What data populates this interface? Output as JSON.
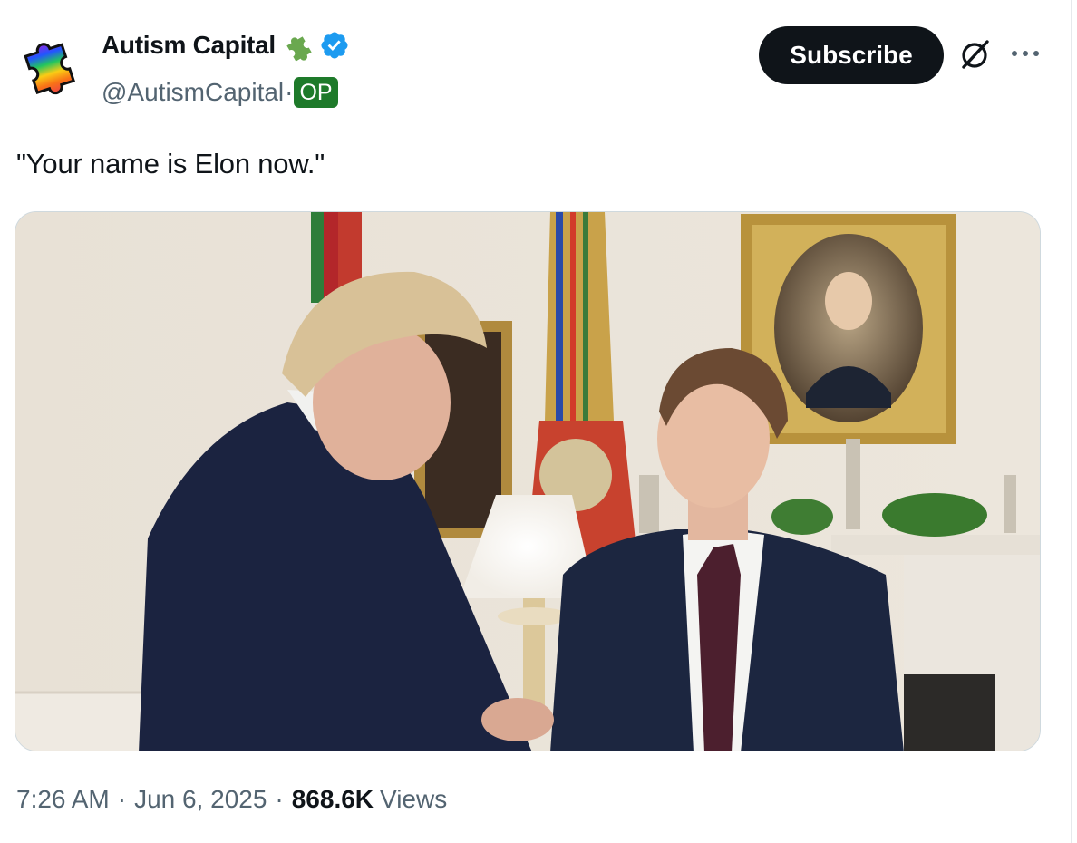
{
  "author": {
    "display_name": "Autism Capital",
    "handle": "@AutismCapital",
    "handle_separator": "·",
    "op_badge": "OP",
    "avatar_icon": "rainbow-puzzle-piece-icon",
    "badge_icons": [
      "green-puzzle-piece-icon",
      "blue-verified-checkmark-icon"
    ]
  },
  "actions": {
    "subscribe_label": "Subscribe",
    "grok_icon": "grok-slash-icon",
    "more_icon": "more-horizontal-icon"
  },
  "post": {
    "text": "\"Your name is Elon now.\"",
    "media_description": "photo"
  },
  "meta": {
    "time": "7:26 AM",
    "separator": "·",
    "date": "Jun 6, 2025",
    "views_count": "868.6K",
    "views_label": "Views"
  },
  "colors": {
    "text_primary": "#0f1419",
    "text_secondary": "#536471",
    "subscribe_bg": "#0f1419",
    "verified_blue": "#1d9bf0",
    "op_green": "#1e7a2a",
    "border": "#cfd9de"
  }
}
